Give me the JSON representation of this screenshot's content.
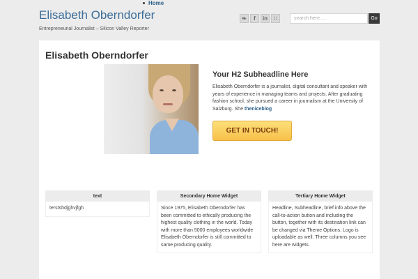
{
  "nav": {
    "items": [
      {
        "label": "Home"
      }
    ]
  },
  "site": {
    "title": "Elisabeth Oberndorfer",
    "description": "Entrepreneurial Journalist – Silicon Valley Reporter"
  },
  "social": {
    "icons": [
      {
        "name": "twitter-icon",
        "glyph": "❧"
      },
      {
        "name": "facebook-icon",
        "glyph": "f"
      },
      {
        "name": "linkedin-icon",
        "glyph": "in"
      },
      {
        "name": "rss-icon",
        "glyph": "∷"
      }
    ]
  },
  "search": {
    "placeholder": "search here ...",
    "button_label": "Go"
  },
  "page": {
    "title": "Elisabeth Oberndorfer",
    "subheadline": "Your H2 Subheadline Here",
    "bio": "Elisabeth Oberndorfer is a journalist, digital consultant and speaker with years of experience in managing teams and projects. After graduating fashion school, she pursued a career in journalism at the University of Salzburg. She ",
    "bio_link": "theniceblog",
    "cta_label": "GET IN TOUCH!"
  },
  "widgets": [
    {
      "title": "text",
      "body": "terstshdjghvjfgh"
    },
    {
      "title": "Secondary Home Widget",
      "body": "Since 1975, Elisabeth Oberndorfer has been committed to ethically producing the highest quality clothing in the world. Today with more than 5000 employees worldwide Elisabeth Oberndorfer is still committed to same producing quality."
    },
    {
      "title": "Tertiary Home Widget",
      "body": "Headline, Subheadline, brief info above the call-to-action button and including the button, together with its destination link can be changed via Theme Options. Logo is uploadable as well. Three columns you see here are widgets."
    }
  ]
}
